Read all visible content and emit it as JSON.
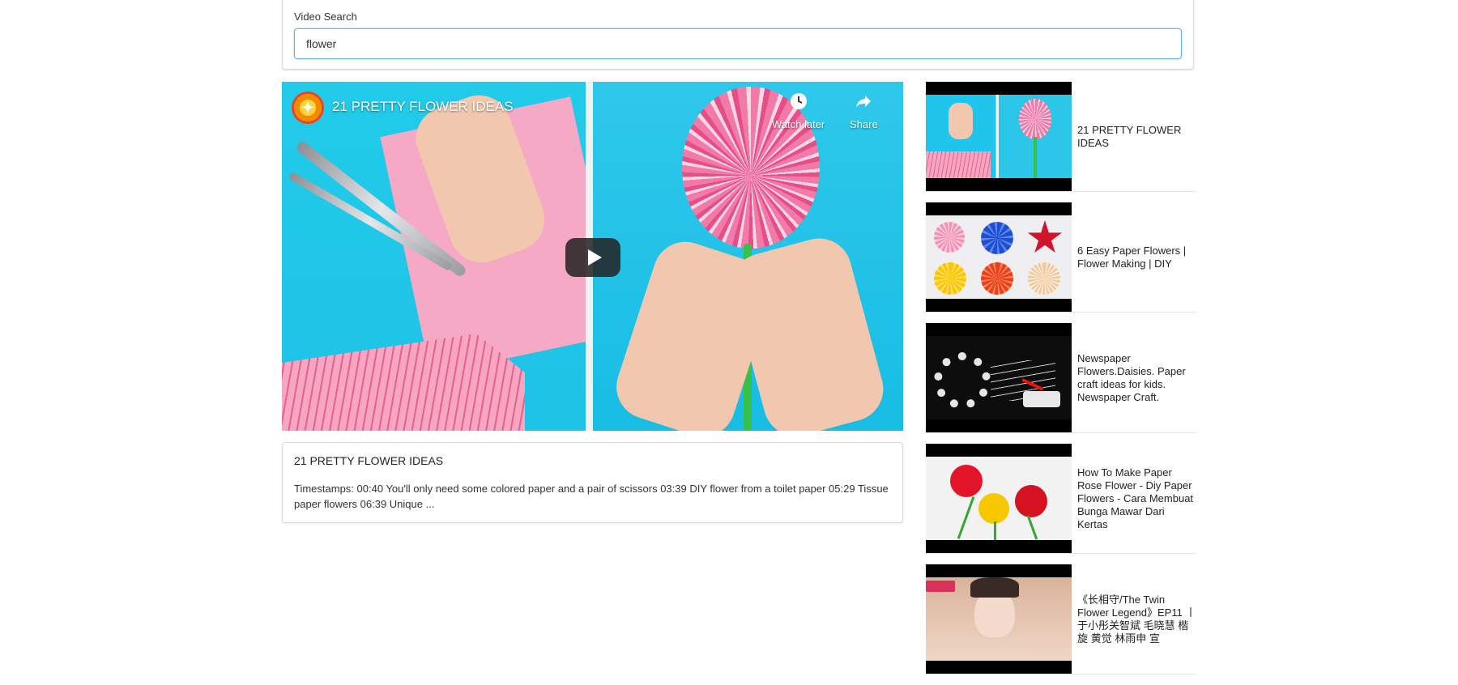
{
  "search": {
    "label": "Video Search",
    "value": "flower",
    "placeholder": ""
  },
  "player": {
    "title": "21 PRETTY FLOWER IDEAS",
    "watch_later_label": "Watch later",
    "share_label": "Share"
  },
  "description": {
    "title": "21 PRETTY FLOWER IDEAS",
    "text": "Timestamps: 00:40 You'll only need some colored paper and a pair of scissors 03:39 DIY flower from a toilet paper 05:29 Tissue paper flowers 06:39 Unique ..."
  },
  "sidebar": {
    "items": [
      {
        "title": "21 PRETTY FLOWER IDEAS"
      },
      {
        "title": "6 Easy Paper Flowers | Flower Making | DIY"
      },
      {
        "title": "Newspaper Flowers.Daisies. Paper craft ideas for kids. Newspaper Craft."
      },
      {
        "title": "How To Make Paper Rose Flower - Diy Paper Flowers - Cara Membuat Bunga Mawar Dari Kertas"
      },
      {
        "title": "《长相守/The Twin Flower Legend》EP11 丨于小彤关智斌 毛晓慧 楷旋 黄觉 林雨申 宣"
      }
    ]
  },
  "colors": {
    "focus_border": "#66afe9",
    "player_bg": "#1fc5ea",
    "play_button": "#212121"
  }
}
